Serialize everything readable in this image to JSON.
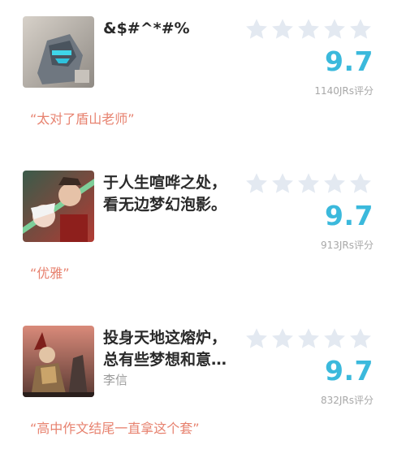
{
  "items": [
    {
      "title": "&$#^*#%",
      "subtitle": "",
      "score": "9.7",
      "count": "1140JRs评分",
      "comment": "“太对了盾山老师”",
      "rating": 0
    },
    {
      "title": "于人生喧哗之处，\n看无边梦幻泡影。",
      "subtitle": "",
      "score": "9.7",
      "count": "913JRs评分",
      "comment": "“优雅”",
      "rating": 0
    },
    {
      "title": "投身天地这熔炉，\n总有些梦想和意…",
      "subtitle": "李信",
      "score": "9.7",
      "count": "832JRs评分",
      "comment": "“高中作文结尾一直拿这个套”",
      "rating": 0
    }
  ],
  "colors": {
    "score": "#3bb9dc",
    "comment": "#e7826f",
    "star_empty": "#e3e9f1"
  },
  "icons": {
    "star": "star-icon",
    "thumb": "hero-artwork"
  }
}
